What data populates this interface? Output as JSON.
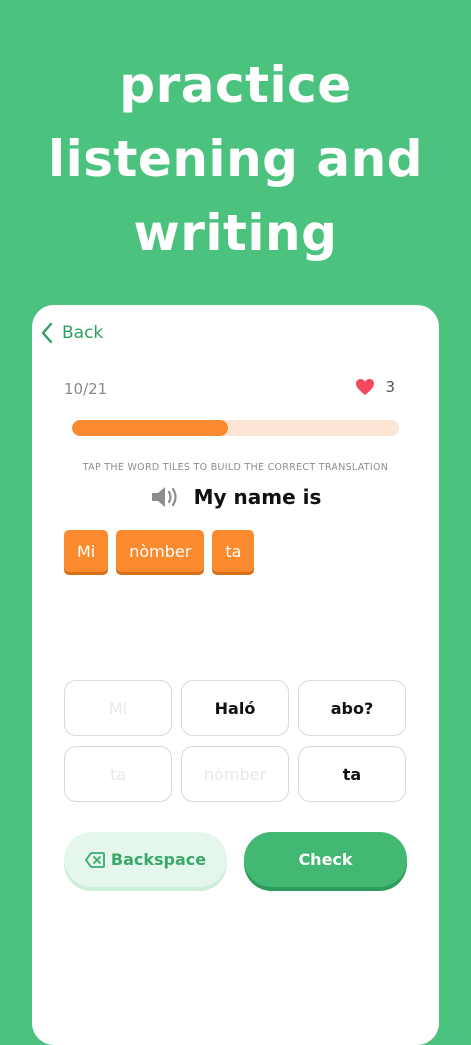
{
  "headline": {
    "line1": "practice",
    "line2": "listening and",
    "line3": "writing"
  },
  "nav": {
    "back_label": "Back"
  },
  "progress": {
    "counter": "10/21",
    "current": 10,
    "total": 21,
    "lives": "3"
  },
  "exercise": {
    "instruction": "TAP THE WORD TILES TO BUILD THE CORRECT TRANSLATION",
    "prompt": "My name is",
    "answer_chips": [
      "Mi",
      "nòmber",
      "ta"
    ]
  },
  "word_bank": [
    {
      "label": "Mi",
      "used": true
    },
    {
      "label": "Haló",
      "used": false
    },
    {
      "label": "abo?",
      "used": false
    },
    {
      "label": "ta",
      "used": true
    },
    {
      "label": "nòmber",
      "used": true
    },
    {
      "label": "ta",
      "used": false
    }
  ],
  "actions": {
    "backspace_label": "Backspace",
    "check_label": "Check"
  },
  "colors": {
    "background": "#4cc27f",
    "accent_orange": "#fb8a2e",
    "accent_green": "#42b873",
    "heart": "#f2475c"
  }
}
